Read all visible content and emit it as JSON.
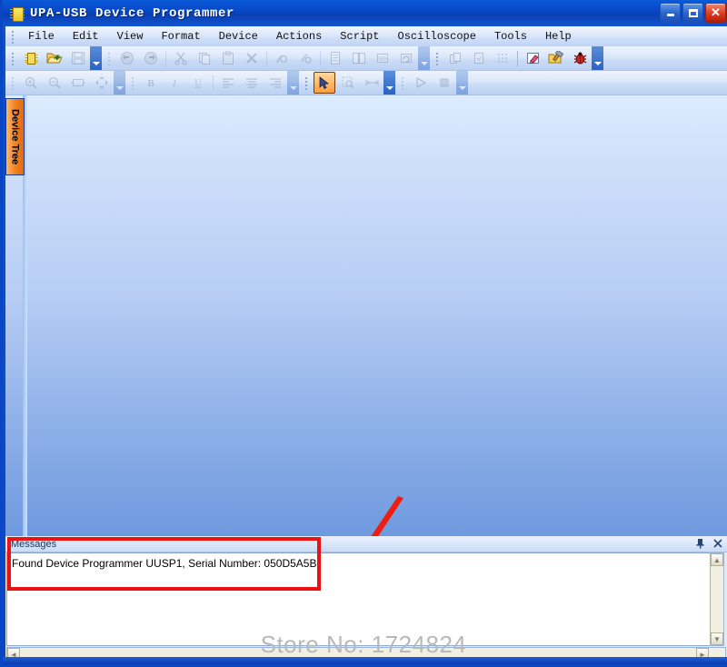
{
  "window": {
    "title": "UPA-USB Device Programmer",
    "icon": "chip-icon",
    "buttons": {
      "minimize": "_",
      "maximize": "□",
      "close": "✕"
    }
  },
  "menu": {
    "items": [
      {
        "label": "File"
      },
      {
        "label": "Edit"
      },
      {
        "label": "View"
      },
      {
        "label": "Format"
      },
      {
        "label": "Device"
      },
      {
        "label": "Actions"
      },
      {
        "label": "Script"
      },
      {
        "label": "Oscilloscope"
      },
      {
        "label": "Tools"
      },
      {
        "label": "Help"
      }
    ]
  },
  "toolbars": [
    {
      "name": "standard-toolbar",
      "groups": [
        {
          "name": "file-group",
          "buttons": [
            {
              "icon": "new-chip-icon",
              "label": "New",
              "enabled": true
            },
            {
              "icon": "open-folder-icon",
              "label": "Open",
              "enabled": true
            },
            {
              "icon": "save-disk-icon",
              "label": "Save",
              "enabled": false
            }
          ]
        },
        {
          "name": "edit-group",
          "buttons": [
            {
              "icon": "undo-icon",
              "label": "Undo",
              "enabled": false
            },
            {
              "icon": "redo-icon",
              "label": "Redo",
              "enabled": false
            },
            {
              "icon": "cut-scissors-icon",
              "label": "Cut",
              "enabled": false
            },
            {
              "icon": "copy-icon",
              "label": "Copy",
              "enabled": false
            },
            {
              "icon": "paste-clipboard-icon",
              "label": "Paste",
              "enabled": false
            },
            {
              "icon": "delete-x-icon",
              "label": "Delete",
              "enabled": false
            },
            {
              "icon": "find-icon",
              "label": "Find",
              "enabled": false
            },
            {
              "icon": "replace-icon",
              "label": "Replace",
              "enabled": false
            },
            {
              "icon": "document-icon",
              "label": "Properties",
              "enabled": false
            },
            {
              "icon": "compare-icon",
              "label": "Compare",
              "enabled": false
            },
            {
              "icon": "hex-icon",
              "label": "Hex View",
              "enabled": false
            },
            {
              "icon": "refresh-icon",
              "label": "Refresh",
              "enabled": false
            }
          ]
        },
        {
          "name": "device-group",
          "buttons": [
            {
              "icon": "read-device-icon",
              "label": "Read",
              "enabled": false
            },
            {
              "icon": "write-device-icon",
              "label": "Write",
              "enabled": false
            },
            {
              "icon": "grid-icon",
              "label": "Grid",
              "enabled": false
            },
            {
              "icon": "eraser-icon",
              "label": "Erase",
              "enabled": true
            },
            {
              "icon": "hammer-icon",
              "label": "Build",
              "enabled": true
            },
            {
              "icon": "bug-icon",
              "label": "Debug",
              "enabled": true
            }
          ]
        }
      ]
    },
    {
      "name": "format-toolbar",
      "groups": [
        {
          "name": "zoom-group",
          "buttons": [
            {
              "icon": "zoom-in-icon",
              "label": "Zoom In",
              "enabled": false
            },
            {
              "icon": "zoom-out-icon",
              "label": "Zoom Out",
              "enabled": false
            },
            {
              "icon": "fit-width-icon",
              "label": "Fit Width",
              "enabled": false
            },
            {
              "icon": "pan-icon",
              "label": "Pan",
              "enabled": false
            }
          ]
        },
        {
          "name": "text-format-group",
          "buttons": [
            {
              "icon": "bold-icon",
              "label": "B",
              "enabled": false
            },
            {
              "icon": "italic-icon",
              "label": "I",
              "enabled": false
            },
            {
              "icon": "underline-icon",
              "label": "U",
              "enabled": false
            },
            {
              "icon": "align-left-icon",
              "label": "Align Left",
              "enabled": false
            },
            {
              "icon": "align-center-icon",
              "label": "Align Center",
              "enabled": false
            },
            {
              "icon": "align-right-icon",
              "label": "Align Right",
              "enabled": false
            }
          ]
        },
        {
          "name": "select-group",
          "buttons": [
            {
              "icon": "cursor-arrow-icon",
              "label": "Select",
              "enabled": true,
              "active": true
            },
            {
              "icon": "zoom-region-icon",
              "label": "Zoom Region",
              "enabled": false
            },
            {
              "icon": "measure-icon",
              "label": "Measure",
              "enabled": false
            }
          ]
        },
        {
          "name": "run-group",
          "buttons": [
            {
              "icon": "play-icon",
              "label": "Run",
              "enabled": false
            },
            {
              "icon": "stop-icon",
              "label": "Stop",
              "enabled": false
            }
          ]
        }
      ]
    }
  ],
  "workspace": {
    "device_tree_tab": "Device Tree"
  },
  "messages": {
    "title": "Messages",
    "pin_icon": "pin-icon",
    "close_icon": "close-icon",
    "lines": [
      "Found Device Programmer UUSP1, Serial Number: 050D5A5B"
    ]
  },
  "annotations": {
    "arrow_color": "#ee1f11",
    "highlight_rect_color": "#ee1111"
  },
  "watermark": {
    "text": "Store No: 1724824"
  },
  "colors": {
    "title_bar": "#0a50d0",
    "workspace_top": "#dcebfd",
    "workspace_bottom": "#6f9adf",
    "accent_orange": "#f08020",
    "annotation_red": "#ee1111"
  }
}
